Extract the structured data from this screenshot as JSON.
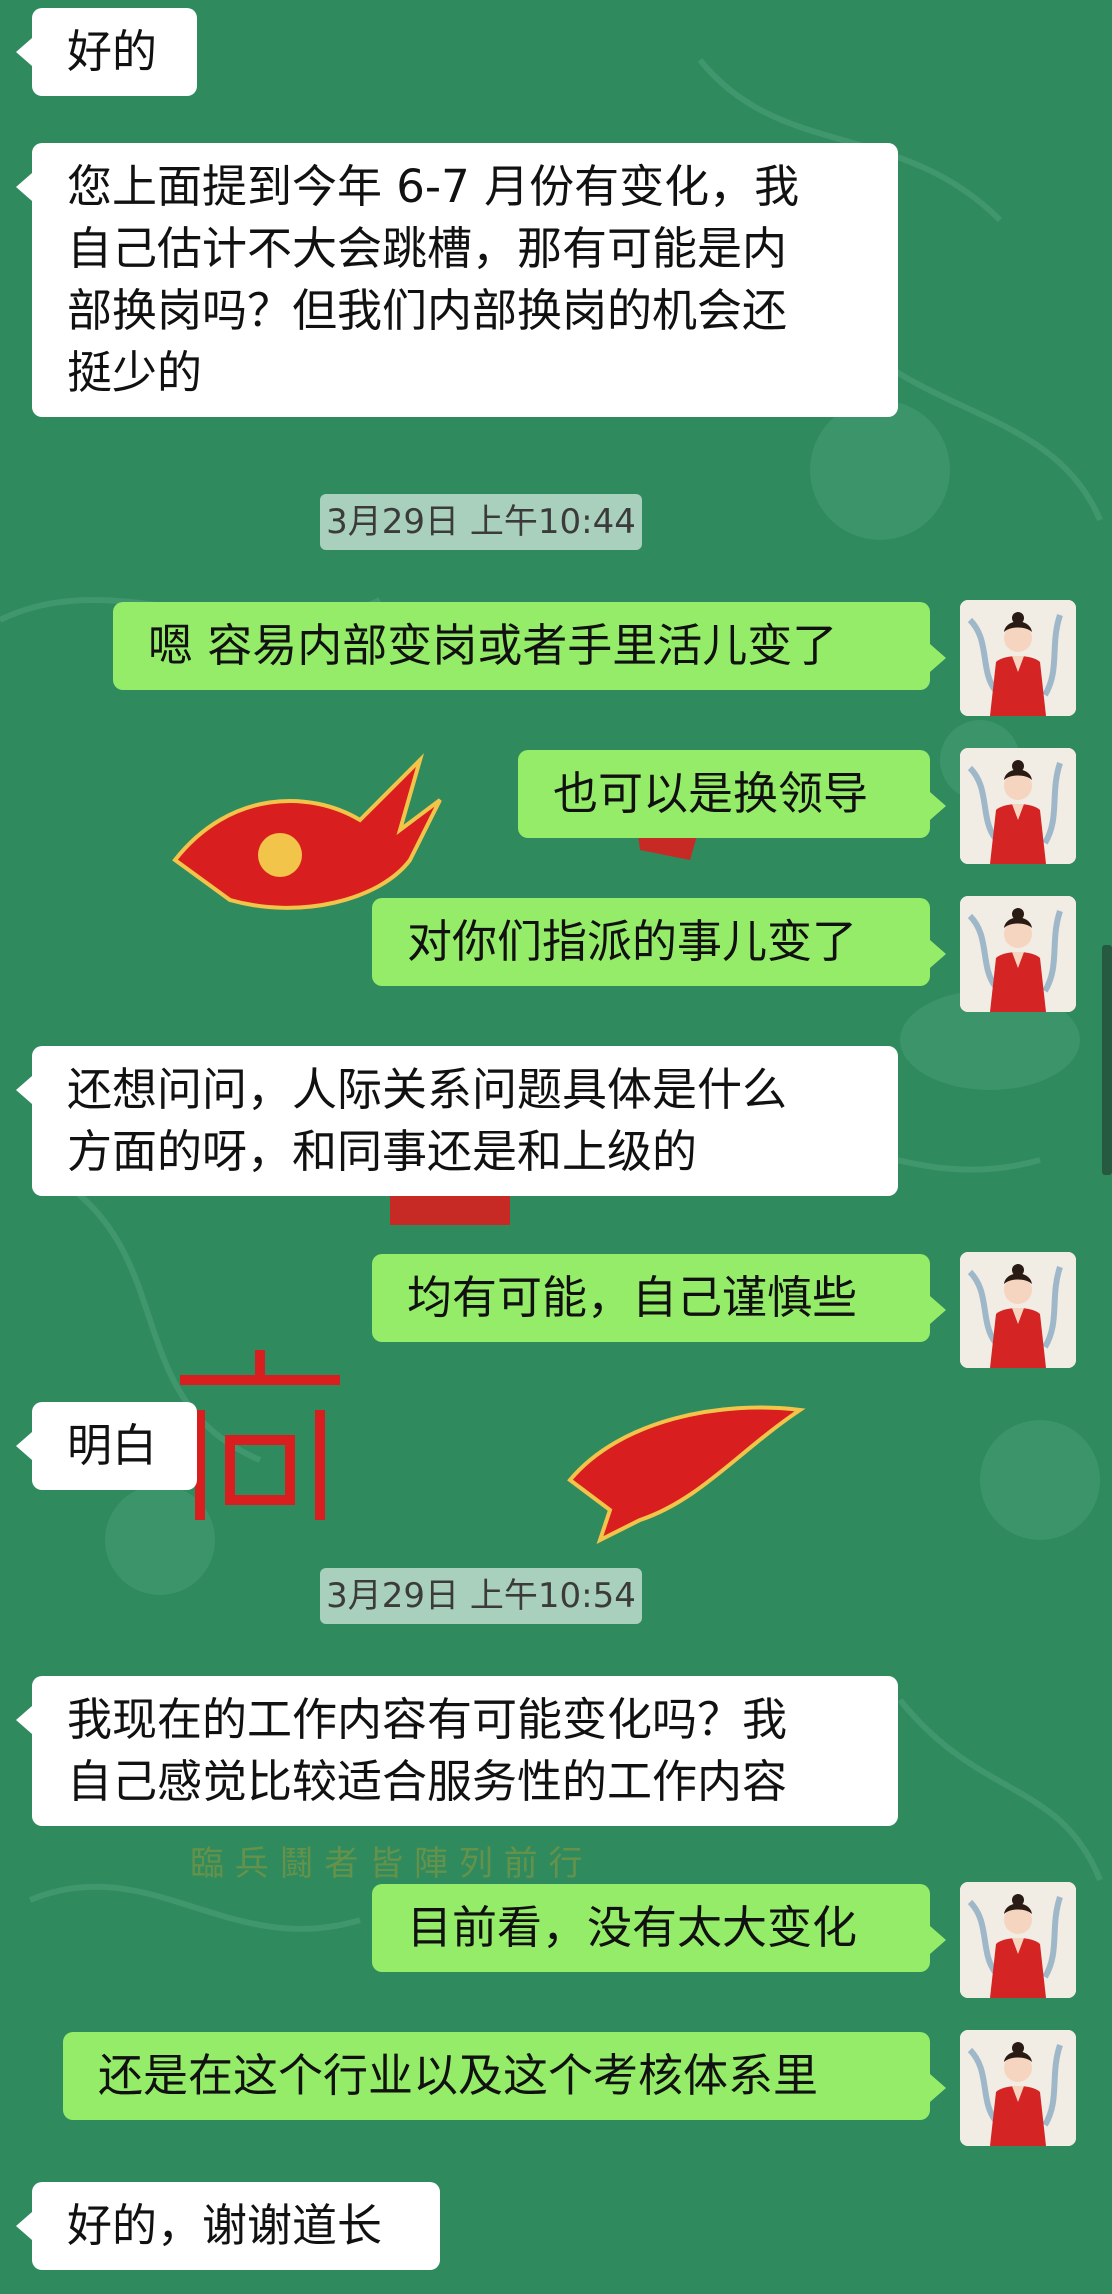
{
  "messages": [
    {
      "id": "m1",
      "side": "in",
      "text": "好的"
    },
    {
      "id": "m2",
      "side": "in",
      "text": "您上面提到今年 6-7 月份有变化，我\n自己估计不大会跳槽，那有可能是内\n部换岗吗？但我们内部换岗的机会还\n挺少的"
    },
    {
      "id": "t1",
      "type": "timestamp",
      "text": "3月29日 上午10:44"
    },
    {
      "id": "m3",
      "side": "out",
      "text": "嗯 容易内部变岗或者手里活儿变了"
    },
    {
      "id": "m4",
      "side": "out",
      "text": "也可以是换领导"
    },
    {
      "id": "m5",
      "side": "out",
      "text": "对你们指派的事儿变了"
    },
    {
      "id": "m6",
      "side": "in",
      "text": "还想问问，人际关系问题具体是什么\n方面的呀，和同事还是和上级的"
    },
    {
      "id": "m7",
      "side": "out",
      "text": "均有可能，自己谨慎些"
    },
    {
      "id": "m8",
      "side": "in",
      "text": "明白"
    },
    {
      "id": "t2",
      "type": "timestamp",
      "text": "3月29日 上午10:54"
    },
    {
      "id": "m9",
      "side": "in",
      "text": "我现在的工作内容有可能变化吗？我\n自己感觉比较适合服务性的工作内容"
    },
    {
      "id": "m10",
      "side": "out",
      "text": "目前看，没有太大变化"
    },
    {
      "id": "m11",
      "side": "out",
      "text": "还是在这个行业以及这个考核体系里"
    },
    {
      "id": "m12",
      "side": "in",
      "text": "好的，谢谢道长"
    }
  ],
  "colors": {
    "background": "#2f8a5e",
    "incoming_bubble": "#ffffff",
    "outgoing_bubble": "#95ec69",
    "ornament_red": "#d81e1e"
  },
  "avatar_icon": "avatar-woman-red-robe-icon"
}
